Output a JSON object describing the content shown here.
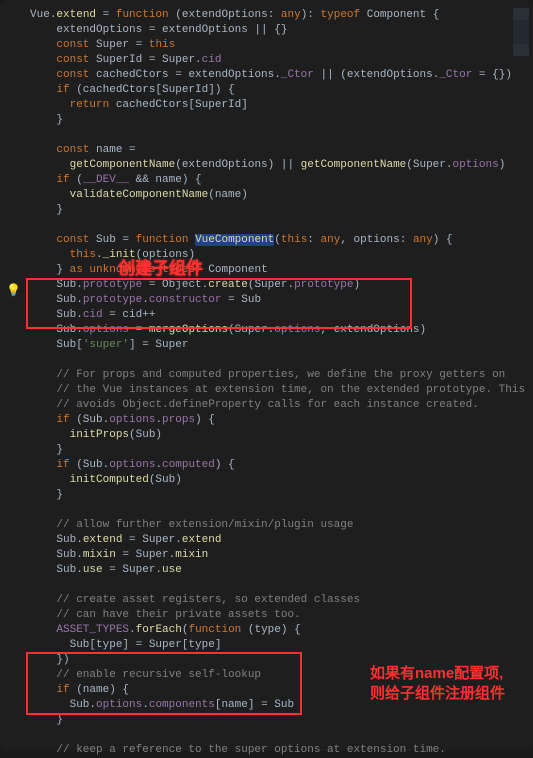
{
  "annotations": {
    "label1": "创建子组件",
    "label2_line1": "如果有name配置项,",
    "label2_line2": "则给子组件注册组件"
  },
  "code": {
    "l1_a": "Vue",
    "l1_b": ".",
    "l1_c": "extend",
    "l1_d": " = ",
    "l1_e": "function",
    "l1_f": " (",
    "l1_g": "extendOptions",
    "l1_h": ": ",
    "l1_i": "any",
    "l1_j": "): ",
    "l1_k": "typeof",
    "l1_l": " Component {",
    "l2_a": "    extendOptions = extendOptions || {}",
    "l3_a": "    ",
    "l3_b": "const",
    "l3_c": " Super = ",
    "l3_d": "this",
    "l4_a": "    ",
    "l4_b": "const",
    "l4_c": " SuperId = Super.",
    "l4_d": "cid",
    "l5_a": "    ",
    "l5_b": "const",
    "l5_c": " cachedCtors = extendOptions.",
    "l5_d": "_Ctor",
    "l5_e": " || (extendOptions.",
    "l5_f": "_Ctor",
    "l5_g": " = {})",
    "l6_a": "    ",
    "l6_b": "if",
    "l6_c": " (cachedCtors[SuperId]) {",
    "l7_a": "      ",
    "l7_b": "return",
    "l7_c": " cachedCtors[SuperId]",
    "l8": "    }",
    "l10_a": "    ",
    "l10_b": "const",
    "l10_c": " name =",
    "l11_a": "      ",
    "l11_b": "getComponentName",
    "l11_c": "(extendOptions) || ",
    "l11_d": "getComponentName",
    "l11_e": "(Super.",
    "l11_f": "options",
    "l11_g": ")",
    "l12_a": "    ",
    "l12_b": "if",
    "l12_c": " (",
    "l12_d": "__DEV__",
    "l12_e": " && name) {",
    "l13_a": "      ",
    "l13_b": "validateComponentName",
    "l13_c": "(name)",
    "l14": "    }",
    "l16_a": "    ",
    "l16_b": "const",
    "l16_c": " Sub = ",
    "l16_d": "function",
    "l16_e": " ",
    "l16_f": "VueComponent",
    "l16_g": "(",
    "l16_h": "this",
    "l16_i": ": ",
    "l16_j": "any",
    "l16_k": ", options: ",
    "l16_l": "any",
    "l16_m": ") {",
    "l17_a": "      ",
    "l17_b": "this",
    "l17_c": ".",
    "l17_d": "_init",
    "l17_e": "(options)",
    "l18_a": "    } ",
    "l18_b": "as",
    "l18_c": " ",
    "l18_d": "unknown",
    "l18_e": " ",
    "l18_f": "as",
    "l18_g": " ",
    "l18_h": "typeof",
    "l18_i": " Component",
    "l19_a": "    Sub.",
    "l19_b": "prototype",
    "l19_c": " = Object.",
    "l19_d": "create",
    "l19_e": "(Super.",
    "l19_f": "prototype",
    "l19_g": ")",
    "l20_a": "    Sub.",
    "l20_b": "prototype",
    "l20_c": ".",
    "l20_d": "constructor",
    "l20_e": " = Sub",
    "l21_a": "    Sub.",
    "l21_b": "cid",
    "l21_c": " = cid++",
    "l22_a": "    Sub.",
    "l22_b": "options",
    "l22_c": " = ",
    "l22_d": "mergeOptions",
    "l22_e": "(Super.",
    "l22_f": "options",
    "l22_g": ", extendOptions)",
    "l23_a": "    Sub[",
    "l23_b": "'super'",
    "l23_c": "] = Super",
    "l25": "    // For props and computed properties, we define the proxy getters on",
    "l26": "    // the Vue instances at extension time, on the extended prototype. This",
    "l27": "    // avoids Object.defineProperty calls for each instance created.",
    "l28_a": "    ",
    "l28_b": "if",
    "l28_c": " (Sub.",
    "l28_d": "options",
    "l28_e": ".",
    "l28_f": "props",
    "l28_g": ") {",
    "l29_a": "      ",
    "l29_b": "initProps",
    "l29_c": "(Sub)",
    "l30": "    }",
    "l31_a": "    ",
    "l31_b": "if",
    "l31_c": " (Sub.",
    "l31_d": "options",
    "l31_e": ".",
    "l31_f": "computed",
    "l31_g": ") {",
    "l32_a": "      ",
    "l32_b": "initComputed",
    "l32_c": "(Sub)",
    "l33": "    }",
    "l35": "    // allow further extension/mixin/plugin usage",
    "l36_a": "    Sub.",
    "l36_b": "extend",
    "l36_c": " = Super.",
    "l36_d": "extend",
    "l37_a": "    Sub.",
    "l37_b": "mixin",
    "l37_c": " = Super.",
    "l37_d": "mixin",
    "l38_a": "    Sub.",
    "l38_b": "use",
    "l38_c": " = Super.",
    "l38_d": "use",
    "l40": "    // create asset registers, so extended classes",
    "l41": "    // can have their private assets too.",
    "l42_a": "    ",
    "l42_b": "ASSET_TYPES",
    "l42_c": ".",
    "l42_d": "forEach",
    "l42_e": "(",
    "l42_f": "function",
    "l42_g": " (type) {",
    "l43": "      Sub[type] = Super[type]",
    "l44": "    })",
    "l45": "    // enable recursive self-lookup",
    "l46_a": "    ",
    "l46_b": "if",
    "l46_c": " (name) {",
    "l47_a": "      Sub.",
    "l47_b": "options",
    "l47_c": ".",
    "l47_d": "components",
    "l47_e": "[name] = Sub",
    "l48": "    }",
    "l50": "    // keep a reference to the super options at extension time."
  }
}
